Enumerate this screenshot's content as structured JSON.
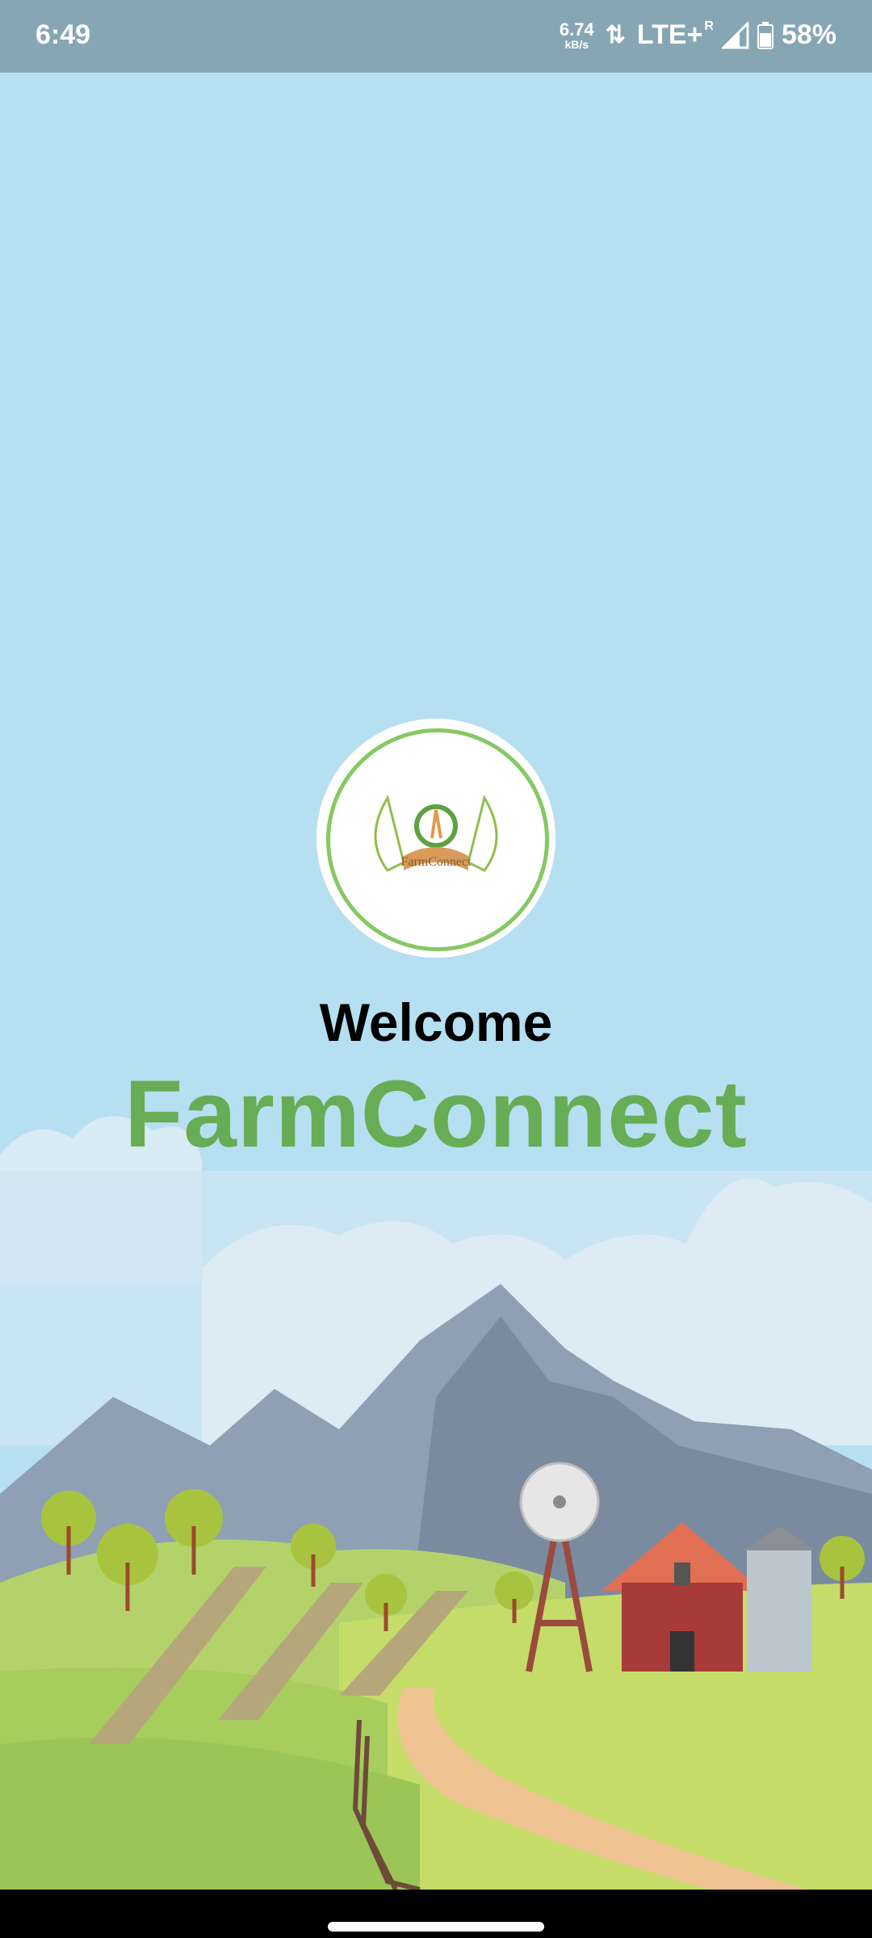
{
  "status_bar": {
    "time": "6:49",
    "speed_value": "6.74",
    "speed_unit": "kB/s",
    "network": "LTE+",
    "roaming": "R",
    "battery": "58%"
  },
  "welcome": {
    "greeting": "Welcome",
    "app_name": "FarmConnect",
    "logo_text": "FarmConnect"
  },
  "colors": {
    "sky": "#b7dff2",
    "brand_green": "#66ad55",
    "status_bar": "#86a6b4"
  }
}
